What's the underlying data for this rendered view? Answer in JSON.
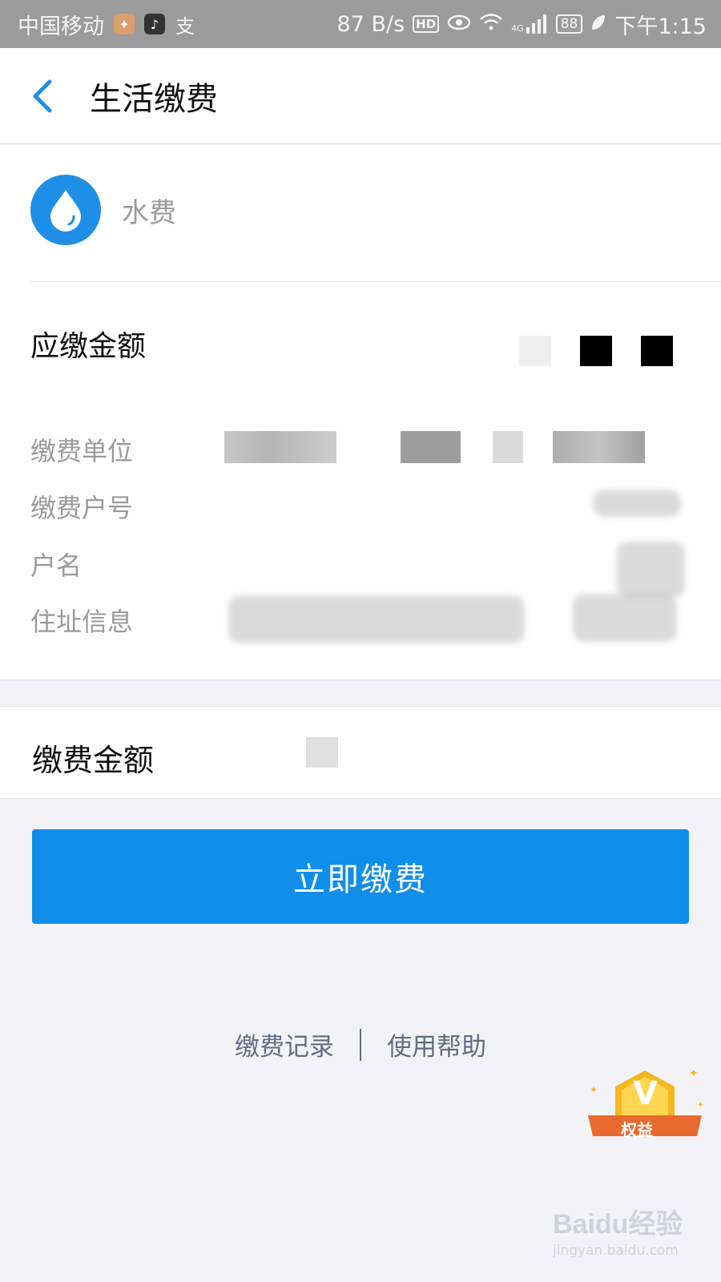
{
  "status_bar": {
    "carrier": "中国移动",
    "network_speed": "87 B/s",
    "hd_label": "HD",
    "network_type": "4G",
    "battery": "88",
    "time": "下午1:15"
  },
  "nav": {
    "title": "生活缴费"
  },
  "biller": {
    "name": "水费",
    "icon": "water-drop-icon",
    "icon_color": "#1f8ee6"
  },
  "bill": {
    "due_label": "应缴金额",
    "fields": [
      {
        "label": "缴费单位"
      },
      {
        "label": "缴费户号"
      },
      {
        "label": "户名"
      },
      {
        "label": "住址信息"
      }
    ]
  },
  "payment": {
    "amount_label": "缴费金额",
    "submit_label": "立即缴费",
    "accent_color": "#108ee9"
  },
  "footer_links": {
    "records": "缴费记录",
    "help": "使用帮助"
  },
  "rewards_badge": {
    "label": "权益",
    "mark": "V"
  },
  "watermark": {
    "brand": "Baidu经验",
    "url": "jingyan.baidu.com"
  }
}
